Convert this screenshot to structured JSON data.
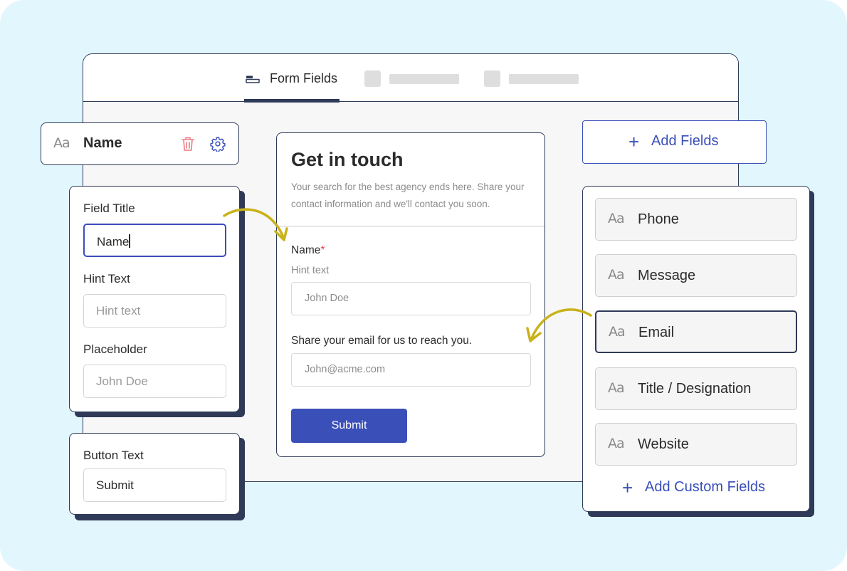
{
  "colors": {
    "background": "#e2f7fd",
    "outline": "#2e3a57",
    "accent": "#3a4fb8",
    "required": "#e5484d",
    "arrow": "#c9b21a",
    "delete_icon": "#f07a82"
  },
  "window": {
    "active_tab": {
      "label": "Form Fields",
      "icon": "form-fields-icon"
    }
  },
  "field_header": {
    "type_icon": "Aa",
    "label": "Name",
    "delete_icon": "trash-icon",
    "settings_icon": "gear-icon"
  },
  "field_settings": {
    "title_label": "Field Title",
    "title_value": "Name",
    "hint_label": "Hint Text",
    "hint_placeholder": "Hint text",
    "placeholder_label": "Placeholder",
    "placeholder_value": "John Doe"
  },
  "button_settings": {
    "label": "Button Text",
    "value": "Submit"
  },
  "form": {
    "title": "Get in touch",
    "description": "Your search for the best agency ends here. Share your contact information and we'll contact you soon.",
    "name_field": {
      "label": "Name",
      "required_mark": "*",
      "hint": "Hint text",
      "placeholder": "John Doe"
    },
    "email_field": {
      "label": "Share your email for us to reach you.",
      "placeholder": "John@acme.com"
    },
    "submit_label": "Submit"
  },
  "add_fields": {
    "icon": "plus-icon",
    "label": "Add Fields"
  },
  "field_types": {
    "items": [
      {
        "icon": "Aa",
        "label": "Phone",
        "selected": false
      },
      {
        "icon": "Aa",
        "label": "Message",
        "selected": false
      },
      {
        "icon": "Aa",
        "label": "Email",
        "selected": true
      },
      {
        "icon": "Aa",
        "label": "Title / Designation",
        "selected": false
      },
      {
        "icon": "Aa",
        "label": "Website",
        "selected": false
      }
    ],
    "add_custom_label": "Add Custom Fields",
    "add_custom_icon": "plus-icon"
  }
}
